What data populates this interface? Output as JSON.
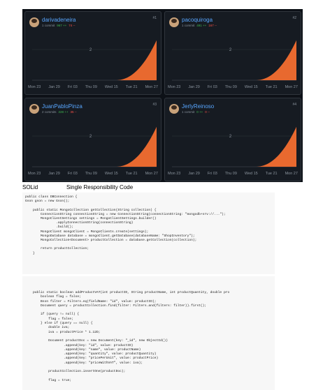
{
  "contributors": [
    {
      "name": "darivadeneira",
      "commits": "1 commit",
      "additions": "967 ++",
      "deletions": "74 --",
      "rank": "#1"
    },
    {
      "name": "pacoquiroga",
      "commits": "1 commit",
      "additions": "491 ++",
      "deletions": "167 --",
      "rank": "#2"
    },
    {
      "name": "JuanPabloPinza",
      "commits": "2 commits",
      "additions": "228 ++",
      "deletions": "35 --",
      "rank": "#3"
    },
    {
      "name": "JerlyReinoso",
      "commits": "1 commit",
      "additions": "0 ++",
      "deletions": "0 --",
      "rank": "#4"
    }
  ],
  "chart_data": [
    {
      "type": "area",
      "title": "darivadeneira",
      "x": [
        "Mon 23",
        "Jan 29",
        "Fri 03",
        "Thu 09",
        "Wed 15",
        "Tue 21",
        "Mon 27"
      ],
      "ylim": [
        0,
        3
      ],
      "y_tick": "2",
      "series": [
        {
          "values": [
            0,
            0,
            0,
            0,
            0,
            0.6,
            2.6
          ]
        }
      ]
    },
    {
      "type": "area",
      "title": "pacoquiroga",
      "x": [
        "Mon 23",
        "Jan 29",
        "Fri 03",
        "Thu 09",
        "Wed 15",
        "Tue 21",
        "Mon 27"
      ],
      "ylim": [
        0,
        3
      ],
      "y_tick": "2",
      "series": [
        {
          "values": [
            0,
            0,
            0,
            0,
            0,
            0.6,
            2.6
          ]
        }
      ]
    },
    {
      "type": "area",
      "title": "JuanPabloPinza",
      "x": [
        "Mon 23",
        "Jan 29",
        "Fri 03",
        "Thu 09",
        "Wed 15",
        "Tue 21",
        "Mon 27"
      ],
      "ylim": [
        0,
        3
      ],
      "y_tick": "2",
      "series": [
        {
          "values": [
            0,
            0,
            0,
            0,
            0,
            0.6,
            2.6
          ]
        }
      ]
    },
    {
      "type": "area",
      "title": "JerlyReinoso",
      "x": [
        "Mon 23",
        "Jan 29",
        "Fri 03",
        "Thu 09",
        "Wed 15",
        "Tue 21",
        "Mon 27"
      ],
      "ylim": [
        0,
        3
      ],
      "y_tick": "2",
      "series": [
        {
          "values": [
            0,
            0,
            0,
            0,
            0,
            0.6,
            2.6
          ]
        }
      ]
    }
  ],
  "colors": {
    "area": "#e8692f",
    "panel": "#0d1117",
    "card": "#161b22",
    "border": "#30363d",
    "link": "#58a6ff",
    "text_muted": "#8b949e",
    "add": "#3fb950",
    "del": "#f85149"
  },
  "labels": {
    "solid": "SOLid",
    "principle": "Single Responsibility Code"
  },
  "code_lines": [
    "public class DBConnection {",
    "Gson gson = new Gson();",
    "",
    "    public static MongoCollection getCollection(String collection) {",
    "        ConnectionString connectionString = new ConnectionString(connectionString: \"mongodb+srv://...\");",
    "        MongoClientSettings settings = MongoClientSettings.builder()",
    "                .applyConnectionString(connectionString)",
    "                .build();",
    "        MongoClient mongoClient = MongoClients.create(settings);",
    "        MongoDatabase database = mongoClient.getDatabase(databaseName: \"ShopInventory\");",
    "        MongoCollection<Document> productCollection = database.getCollection(collection);",
    "",
    "        return productCollection;",
    "    }",
    "",
    "",
    "",
    "",
    "    public static boolean addProductVAT(int productID, String productName, int productQuantity, double pro",
    "        boolean flag = false;",
    "        Bson filter = Filters.eq(fieldName: \"id\", value: productID);",
    "        Document query = productCollection.find(filter: Filters.and(filters: filter)).first();",
    "",
    "        if (query != null) {",
    "            flag = false;",
    "        } else if (query == null) {",
    "            double iva;",
    "            iva = productPrice * 1.12D;",
    "",
    "            Document productDoc = new Document(key: \"_id\", new ObjectId())",
    "                    .append(key: \"id\", value: productID)",
    "                    .append(key: \"name\", value: productName)",
    "                    .append(key: \"quantity\", value: productQuantity)",
    "                    .append(key: \"pricePerUnit\", value: productPrice)",
    "                    .append(key: \"priceWithVAT\", value: iva);",
    "",
    "            productCollection.insertOne(productDoc);",
    "",
    "            flag = true;"
  ]
}
